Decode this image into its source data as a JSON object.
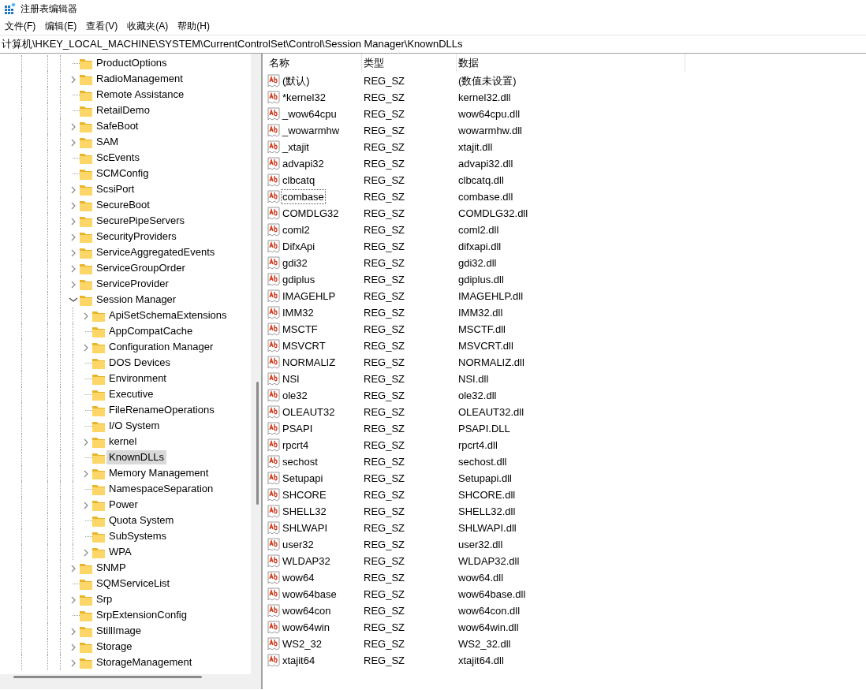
{
  "window": {
    "title": "注册表编辑器"
  },
  "menu": [
    "文件(F)",
    "编辑(E)",
    "查看(V)",
    "收藏夹(A)",
    "帮助(H)"
  ],
  "address": "计算机\\HKEY_LOCAL_MACHINE\\SYSTEM\\CurrentControlSet\\Control\\Session Manager\\KnownDLLs",
  "tree": [
    {
      "label": "ProductOptions",
      "has_children": false,
      "selected": false
    },
    {
      "label": "RadioManagement",
      "has_children": true,
      "selected": false
    },
    {
      "label": "Remote Assistance",
      "has_children": false,
      "selected": false
    },
    {
      "label": "RetailDemo",
      "has_children": false,
      "selected": false
    },
    {
      "label": "SafeBoot",
      "has_children": true,
      "selected": false
    },
    {
      "label": "SAM",
      "has_children": true,
      "selected": false
    },
    {
      "label": "ScEvents",
      "has_children": false,
      "selected": false
    },
    {
      "label": "SCMConfig",
      "has_children": false,
      "selected": false
    },
    {
      "label": "ScsiPort",
      "has_children": true,
      "selected": false
    },
    {
      "label": "SecureBoot",
      "has_children": true,
      "selected": false
    },
    {
      "label": "SecurePipeServers",
      "has_children": true,
      "selected": false
    },
    {
      "label": "SecurityProviders",
      "has_children": true,
      "selected": false
    },
    {
      "label": "ServiceAggregatedEvents",
      "has_children": true,
      "selected": false
    },
    {
      "label": "ServiceGroupOrder",
      "has_children": true,
      "selected": false
    },
    {
      "label": "ServiceProvider",
      "has_children": true,
      "selected": false
    },
    {
      "label": "Session Manager",
      "has_children": true,
      "expanded": true,
      "selected": false,
      "children": [
        {
          "label": "ApiSetSchemaExtensions",
          "has_children": true,
          "selected": false
        },
        {
          "label": "AppCompatCache",
          "has_children": false,
          "selected": false
        },
        {
          "label": "Configuration Manager",
          "has_children": true,
          "selected": false
        },
        {
          "label": "DOS Devices",
          "has_children": false,
          "selected": false
        },
        {
          "label": "Environment",
          "has_children": false,
          "selected": false
        },
        {
          "label": "Executive",
          "has_children": false,
          "selected": false
        },
        {
          "label": "FileRenameOperations",
          "has_children": false,
          "selected": false
        },
        {
          "label": "I/O System",
          "has_children": false,
          "selected": false
        },
        {
          "label": "kernel",
          "has_children": true,
          "selected": false
        },
        {
          "label": "KnownDLLs",
          "has_children": false,
          "selected": true
        },
        {
          "label": "Memory Management",
          "has_children": true,
          "selected": false
        },
        {
          "label": "NamespaceSeparation",
          "has_children": false,
          "selected": false
        },
        {
          "label": "Power",
          "has_children": true,
          "selected": false
        },
        {
          "label": "Quota System",
          "has_children": false,
          "selected": false
        },
        {
          "label": "SubSystems",
          "has_children": false,
          "selected": false
        },
        {
          "label": "WPA",
          "has_children": true,
          "selected": false
        }
      ]
    },
    {
      "label": "SNMP",
      "has_children": true,
      "selected": false
    },
    {
      "label": "SQMServiceList",
      "has_children": false,
      "selected": false
    },
    {
      "label": "Srp",
      "has_children": true,
      "selected": false
    },
    {
      "label": "SrpExtensionConfig",
      "has_children": false,
      "selected": false
    },
    {
      "label": "StillImage",
      "has_children": true,
      "selected": false
    },
    {
      "label": "Storage",
      "has_children": true,
      "selected": false
    },
    {
      "label": "StorageManagement",
      "has_children": true,
      "selected": false
    }
  ],
  "table": {
    "columns": [
      "名称",
      "类型",
      "数据"
    ],
    "rows": [
      {
        "name": "(默认)",
        "type": "REG_SZ",
        "data": "(数值未设置)",
        "focused": false
      },
      {
        "name": "*kernel32",
        "type": "REG_SZ",
        "data": "kernel32.dll",
        "focused": false
      },
      {
        "name": "_wow64cpu",
        "type": "REG_SZ",
        "data": "wow64cpu.dll",
        "focused": false
      },
      {
        "name": "_wowarmhw",
        "type": "REG_SZ",
        "data": "wowarmhw.dll",
        "focused": false
      },
      {
        "name": "_xtajit",
        "type": "REG_SZ",
        "data": "xtajit.dll",
        "focused": false
      },
      {
        "name": "advapi32",
        "type": "REG_SZ",
        "data": "advapi32.dll",
        "focused": false
      },
      {
        "name": "clbcatq",
        "type": "REG_SZ",
        "data": "clbcatq.dll",
        "focused": false
      },
      {
        "name": "combase",
        "type": "REG_SZ",
        "data": "combase.dll",
        "focused": true
      },
      {
        "name": "COMDLG32",
        "type": "REG_SZ",
        "data": "COMDLG32.dll",
        "focused": false
      },
      {
        "name": "coml2",
        "type": "REG_SZ",
        "data": "coml2.dll",
        "focused": false
      },
      {
        "name": "DifxApi",
        "type": "REG_SZ",
        "data": "difxapi.dll",
        "focused": false
      },
      {
        "name": "gdi32",
        "type": "REG_SZ",
        "data": "gdi32.dll",
        "focused": false
      },
      {
        "name": "gdiplus",
        "type": "REG_SZ",
        "data": "gdiplus.dll",
        "focused": false
      },
      {
        "name": "IMAGEHLP",
        "type": "REG_SZ",
        "data": "IMAGEHLP.dll",
        "focused": false
      },
      {
        "name": "IMM32",
        "type": "REG_SZ",
        "data": "IMM32.dll",
        "focused": false
      },
      {
        "name": "MSCTF",
        "type": "REG_SZ",
        "data": "MSCTF.dll",
        "focused": false
      },
      {
        "name": "MSVCRT",
        "type": "REG_SZ",
        "data": "MSVCRT.dll",
        "focused": false
      },
      {
        "name": "NORMALIZ",
        "type": "REG_SZ",
        "data": "NORMALIZ.dll",
        "focused": false
      },
      {
        "name": "NSI",
        "type": "REG_SZ",
        "data": "NSI.dll",
        "focused": false
      },
      {
        "name": "ole32",
        "type": "REG_SZ",
        "data": "ole32.dll",
        "focused": false
      },
      {
        "name": "OLEAUT32",
        "type": "REG_SZ",
        "data": "OLEAUT32.dll",
        "focused": false
      },
      {
        "name": "PSAPI",
        "type": "REG_SZ",
        "data": "PSAPI.DLL",
        "focused": false
      },
      {
        "name": "rpcrt4",
        "type": "REG_SZ",
        "data": "rpcrt4.dll",
        "focused": false
      },
      {
        "name": "sechost",
        "type": "REG_SZ",
        "data": "sechost.dll",
        "focused": false
      },
      {
        "name": "Setupapi",
        "type": "REG_SZ",
        "data": "Setupapi.dll",
        "focused": false
      },
      {
        "name": "SHCORE",
        "type": "REG_SZ",
        "data": "SHCORE.dll",
        "focused": false
      },
      {
        "name": "SHELL32",
        "type": "REG_SZ",
        "data": "SHELL32.dll",
        "focused": false
      },
      {
        "name": "SHLWAPI",
        "type": "REG_SZ",
        "data": "SHLWAPI.dll",
        "focused": false
      },
      {
        "name": "user32",
        "type": "REG_SZ",
        "data": "user32.dll",
        "focused": false
      },
      {
        "name": "WLDAP32",
        "type": "REG_SZ",
        "data": "WLDAP32.dll",
        "focused": false
      },
      {
        "name": "wow64",
        "type": "REG_SZ",
        "data": "wow64.dll",
        "focused": false
      },
      {
        "name": "wow64base",
        "type": "REG_SZ",
        "data": "wow64base.dll",
        "focused": false
      },
      {
        "name": "wow64con",
        "type": "REG_SZ",
        "data": "wow64con.dll",
        "focused": false
      },
      {
        "name": "wow64win",
        "type": "REG_SZ",
        "data": "wow64win.dll",
        "focused": false
      },
      {
        "name": "WS2_32",
        "type": "REG_SZ",
        "data": "WS2_32.dll",
        "focused": false
      },
      {
        "name": "xtajit64",
        "type": "REG_SZ",
        "data": "xtajit64.dll",
        "focused": false
      }
    ]
  }
}
